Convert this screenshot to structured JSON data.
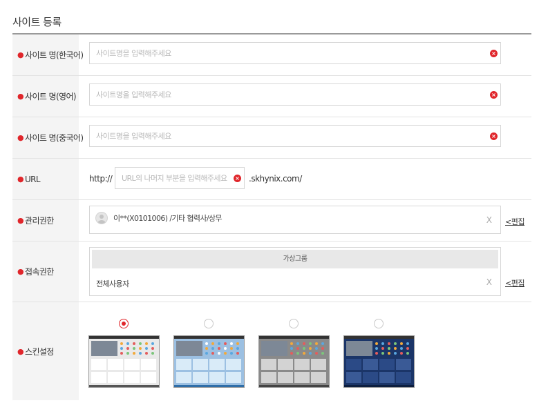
{
  "page": {
    "title": "사이트 등록"
  },
  "form": {
    "site_name_ko": {
      "label": "사이트 명(한국어)",
      "placeholder": "사이트명을 입력해주세요",
      "value": ""
    },
    "site_name_en": {
      "label": "사이트 명(영어)",
      "placeholder": "사이트명을 입력해주세요",
      "value": ""
    },
    "site_name_zh": {
      "label": "사이트 명(중국어)",
      "placeholder": "사이트명을 입력해주세요",
      "value": ""
    },
    "url": {
      "label": "URL",
      "prefix": "http://",
      "placeholder": "URL의 나머지 부분을 입력해주세요",
      "suffix": ".skhynix.com/"
    },
    "admin": {
      "label": "관리권한",
      "user": "이**(X0101006) /기타 협력사/상무",
      "remove": "X",
      "edit": "<편집"
    },
    "access": {
      "label": "접속권한",
      "group_header": "가상그룹",
      "item": "전체사용자",
      "remove": "X",
      "edit": "<편집"
    },
    "skin": {
      "label": "스킨설정",
      "selected_index": 0
    }
  },
  "icons": {
    "required": "bullet-icon",
    "clear": "clear-circle-icon",
    "avatar": "user-avatar-icon"
  },
  "colors": {
    "accent": "#e0262b",
    "label_bg": "#f4f4f4",
    "border": "#d6d6d6"
  }
}
